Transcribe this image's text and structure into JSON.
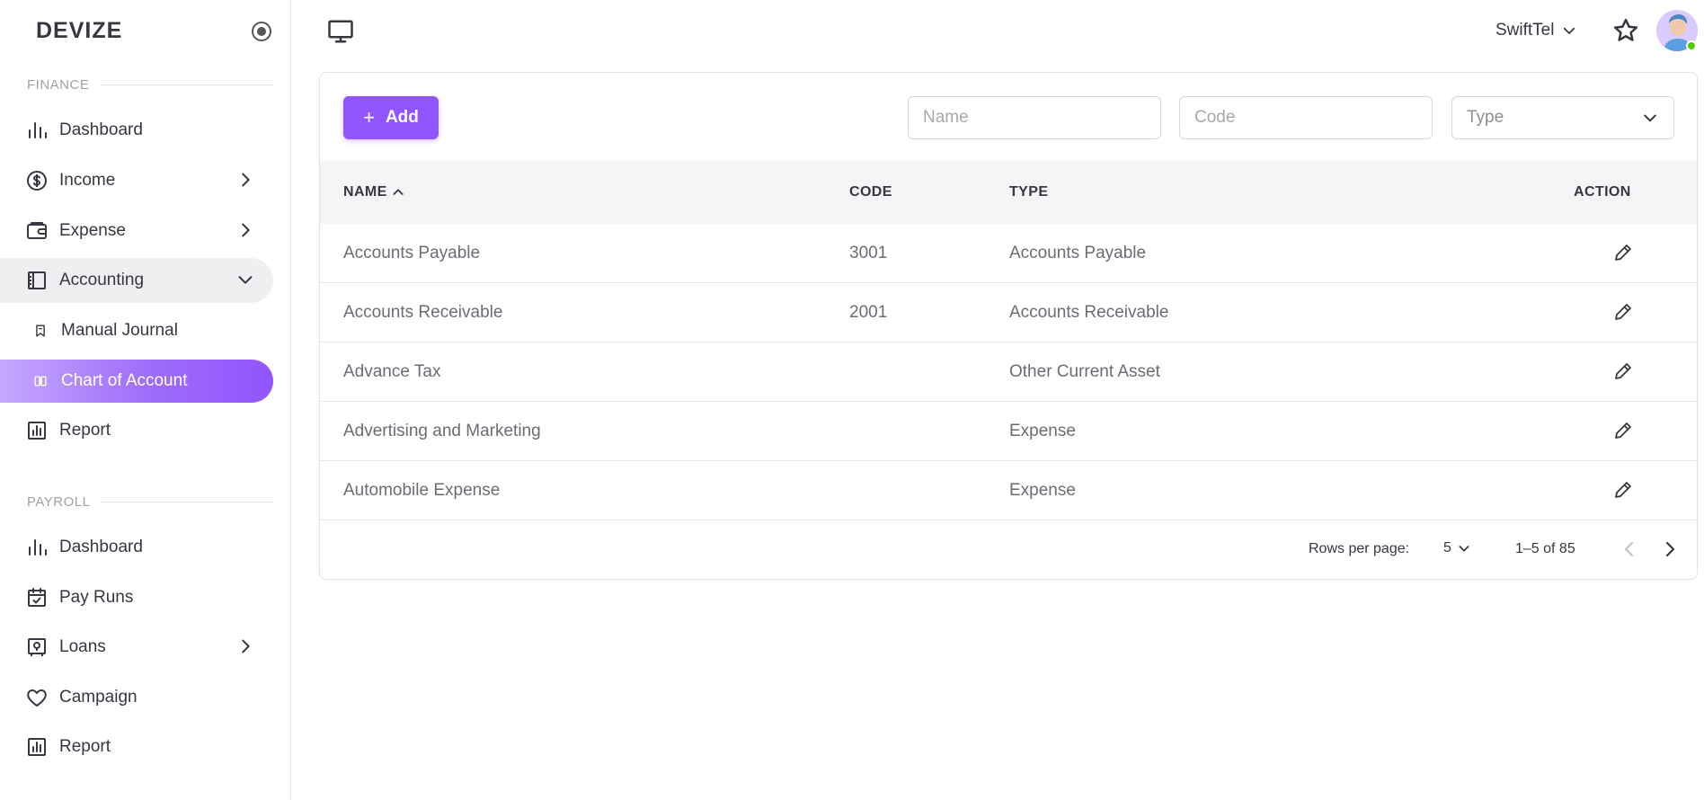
{
  "brand": "DEVIZE",
  "sidebar": {
    "finance_label": "FINANCE",
    "finance_items": [
      {
        "label": "Dashboard",
        "icon": "bar-chart-icon"
      },
      {
        "label": "Income",
        "icon": "dollar-circle-icon"
      },
      {
        "label": "Expense",
        "icon": "wallet-icon"
      },
      {
        "label": "Accounting",
        "icon": "ledger-icon"
      },
      {
        "label": "Manual Journal",
        "icon": "bookmark-icon"
      },
      {
        "label": "Chart of Account",
        "icon": "book-open-icon"
      },
      {
        "label": "Report",
        "icon": "report-chart-icon"
      }
    ],
    "payroll_label": "PAYROLL",
    "payroll_items": [
      {
        "label": "Dashboard",
        "icon": "bar-chart-icon"
      },
      {
        "label": "Pay Runs",
        "icon": "calendar-check-icon"
      },
      {
        "label": "Loans",
        "icon": "safe-icon"
      },
      {
        "label": "Campaign",
        "icon": "heart-icon"
      },
      {
        "label": "Report",
        "icon": "report-chart-icon"
      }
    ]
  },
  "header": {
    "company": "SwiftTel"
  },
  "toolbar": {
    "add_label": "Add",
    "name_placeholder": "Name",
    "code_placeholder": "Code",
    "type_placeholder": "Type"
  },
  "table": {
    "columns": [
      "NAME",
      "CODE",
      "TYPE",
      "ACTION"
    ],
    "rows": [
      {
        "name": "Accounts Payable",
        "code": "3001",
        "type": "Accounts Payable"
      },
      {
        "name": "Accounts Receivable",
        "code": "2001",
        "type": "Accounts Receivable"
      },
      {
        "name": "Advance Tax",
        "code": "",
        "type": "Other Current Asset"
      },
      {
        "name": "Advertising and Marketing",
        "code": "",
        "type": "Expense"
      },
      {
        "name": "Automobile Expense",
        "code": "",
        "type": "Expense"
      }
    ]
  },
  "pagination": {
    "rows_per_page_label": "Rows per page:",
    "rows_per_page": "5",
    "range": "1–5 of 85"
  },
  "colors": {
    "accent": "#9155fd",
    "text": "#3a3541",
    "muted": "#6d6b74",
    "status_online": "#56ca00"
  }
}
